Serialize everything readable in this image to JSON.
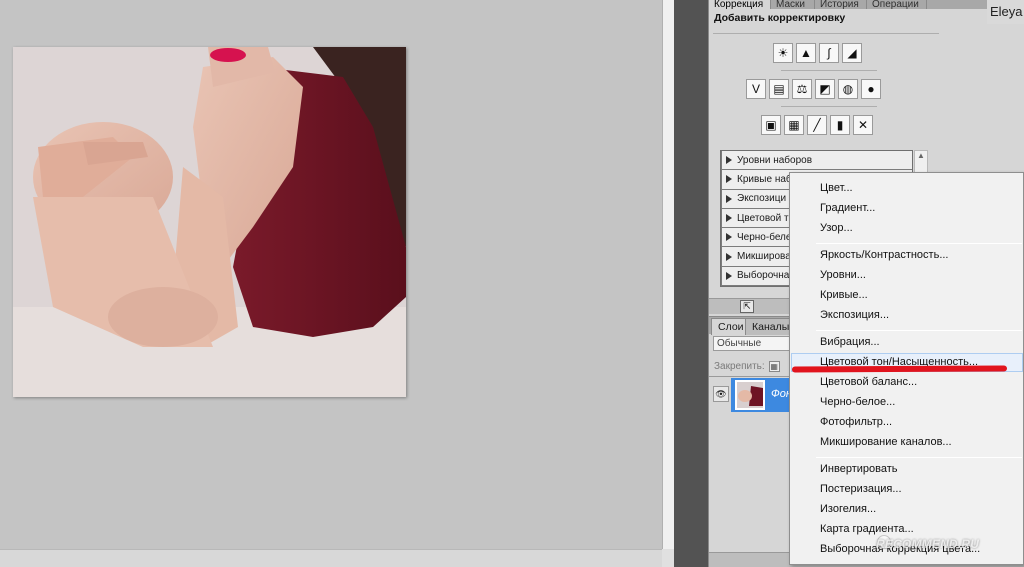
{
  "panel_tabs": [
    {
      "label": "Коррекция",
      "active": true
    },
    {
      "label": "Маски",
      "active": false
    },
    {
      "label": "История",
      "active": false
    },
    {
      "label": "Операции",
      "active": false
    }
  ],
  "user_name": "Eleya",
  "adjustments": {
    "title": "Добавить корректировку",
    "icon_rows": [
      [
        "brightness-icon",
        "levels-icon",
        "curves-icon",
        "exposure-icon"
      ],
      [
        "vibrance-icon",
        "hue-saturation-icon",
        "color-balance-icon",
        "black-white-icon",
        "photo-filter-icon",
        "channel-mixer-icon"
      ],
      [
        "invert-icon",
        "posterize-icon",
        "threshold-icon",
        "gradient-map-icon",
        "selective-color-icon"
      ]
    ],
    "presets": [
      "Уровни наборов",
      "Кривые набо",
      "Экспозици",
      "Цветовой т",
      "Черно-беле",
      "Микширова",
      "Выборочна"
    ]
  },
  "layers": {
    "tabs": [
      {
        "label": "Слои",
        "active": true
      },
      {
        "label": "Каналы",
        "active": false
      }
    ],
    "blend_mode": "Обычные",
    "lock_label": "Закрепить:",
    "layer_name": "Фон"
  },
  "context_menu": {
    "groups": [
      [
        "Цвет...",
        "Градиент...",
        "Узор..."
      ],
      [
        "Яркость/Контрастность...",
        "Уровни...",
        "Кривые...",
        "Экспозиция..."
      ],
      [
        "Вибрация...",
        "Цветовой тон/Насыщенность...",
        "Цветовой баланс...",
        "Черно-белое...",
        "Фотофильтр...",
        "Микширование каналов..."
      ],
      [
        "Инвертировать",
        "Постеризация...",
        "Изогелия...",
        "Карта градиента...",
        "Выборочная коррекция цвета..."
      ]
    ],
    "highlighted": "Цветовой тон/Насыщенность..."
  },
  "watermark": "RECOMMEND.RU",
  "colors": {
    "selection_blue": "#3d89e0",
    "annotation_red": "#e1141e",
    "dress": "#6e1424",
    "lips": "#d6124f"
  }
}
